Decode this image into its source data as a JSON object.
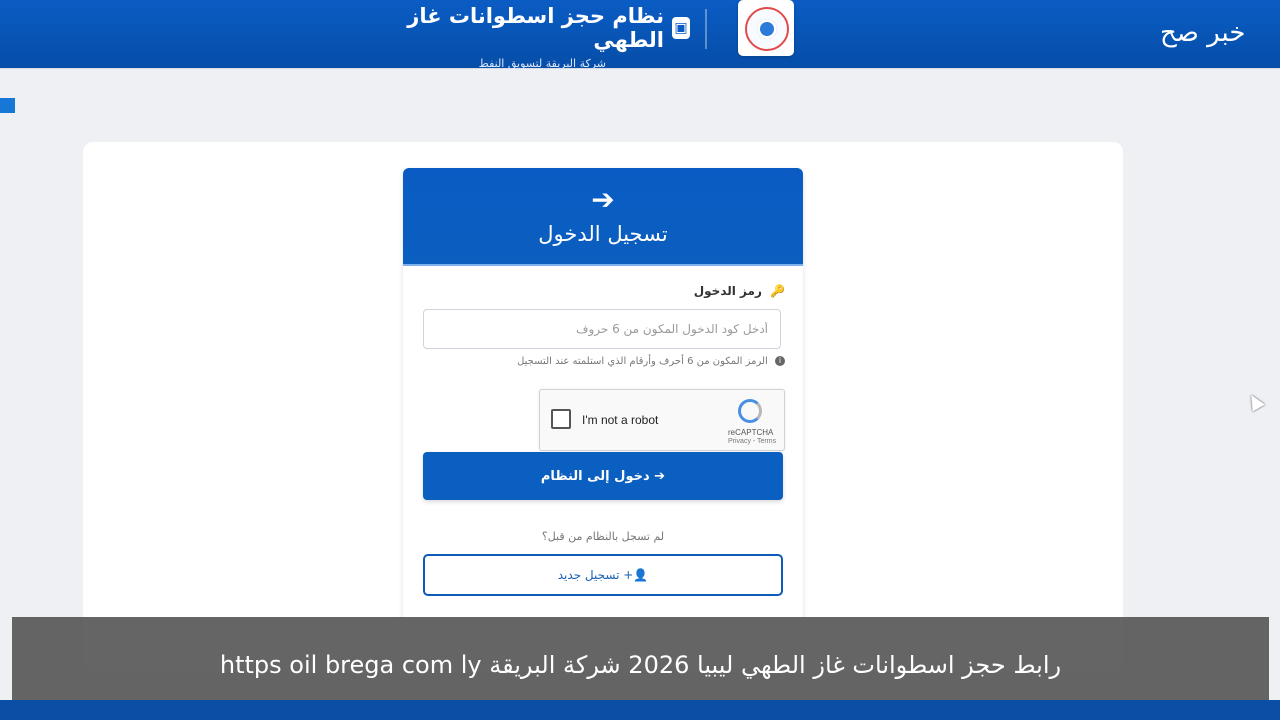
{
  "header": {
    "system_title": "نظام حجز اسطوانات غاز الطهي",
    "company_subtitle": "شركة البريقة لتسويق النفط",
    "channel_brand": "خبر صح"
  },
  "login": {
    "title": "تسجيل الدخول",
    "code_label": "رمز الدخول",
    "code_placeholder": "أدخل كود الدخول المكون من 6 حروف",
    "code_hint": "الرمز المكون من 6 أحرف وأرقام الذي استلمته عند التسجيل",
    "captcha_text": "I'm not a robot",
    "captcha_brand": "reCAPTCHA",
    "captcha_links": "Privacy - Terms",
    "login_button": "دخول إلى النظام",
    "not_registered": "لم تسجل بالنظام من قبل؟",
    "register_button": "تسجيل جديد"
  },
  "overlay": {
    "caption": "رابط حجز اسطوانات غاز الطهي ليبيا 2026 شركة البريقة https oil brega com ly"
  },
  "colors": {
    "primary_blue": "#0a5cc4",
    "page_bg": "#eef0f4",
    "caption_bg": "#585858"
  },
  "icons": {
    "login": "sign-in-icon",
    "key": "key-icon",
    "info": "info-icon",
    "user_plus": "user-plus-icon",
    "pump": "gas-pump-icon"
  }
}
